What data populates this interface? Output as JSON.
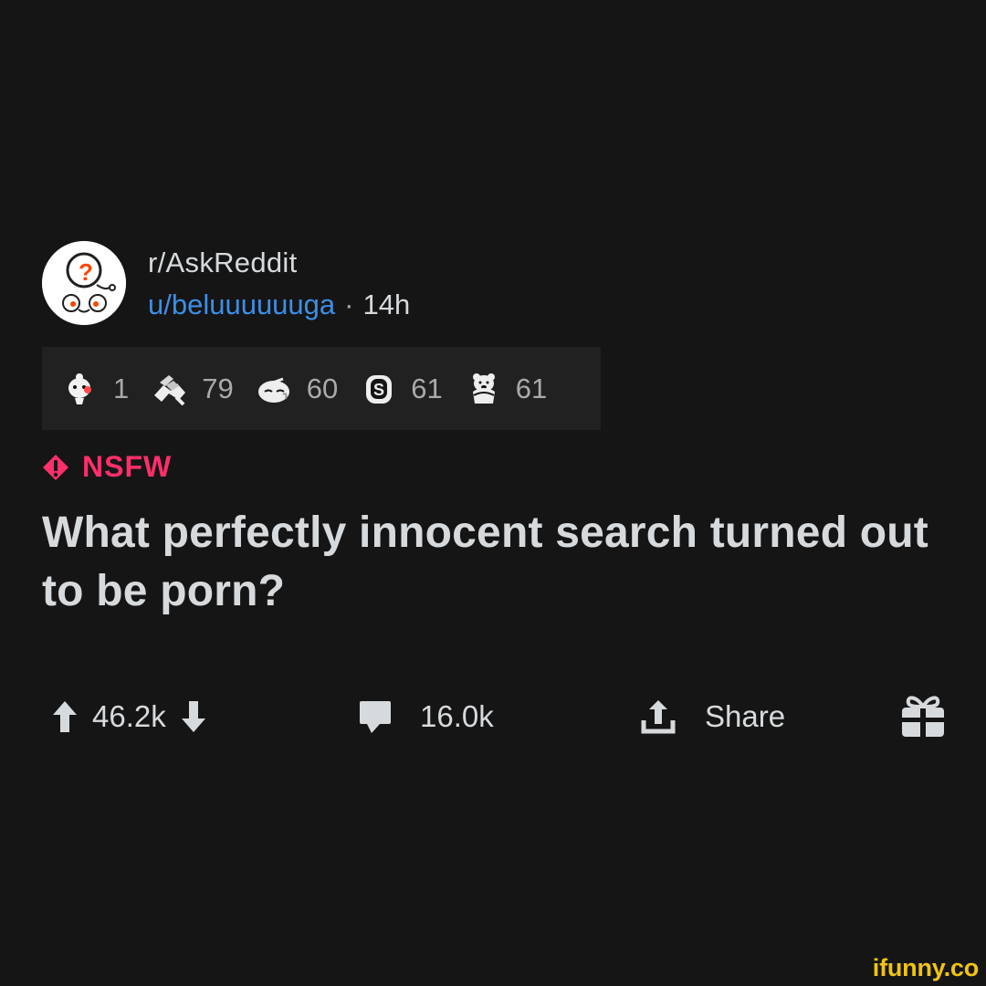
{
  "header": {
    "subreddit": "r/AskReddit",
    "username": "u/beluuuuuuga",
    "separator": "·",
    "age": "14h"
  },
  "awards": [
    {
      "icon": "wholesome-seal-icon",
      "count": "1"
    },
    {
      "icon": "handshake-icon",
      "count": "79"
    },
    {
      "icon": "narwhal-salute-icon",
      "count": "60"
    },
    {
      "icon": "helpful-s-icon",
      "count": "61"
    },
    {
      "icon": "polar-bear-icon",
      "count": "61"
    }
  ],
  "nsfw": {
    "label": "NSFW",
    "color": "#ff2f6a"
  },
  "post": {
    "title": "What perfectly innocent search turned out to be porn?"
  },
  "actions": {
    "votes": "46.2k",
    "comments": "16.0k",
    "share": "Share"
  },
  "watermark": "ifunny.co",
  "colors": {
    "background": "#151516",
    "text": "#d7dadc",
    "username": "#3d8ee5",
    "awards_bar": "#212122",
    "watermark": "#f1c40f"
  }
}
